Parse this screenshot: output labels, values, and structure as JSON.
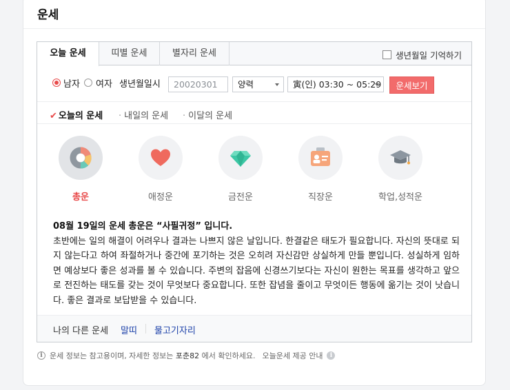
{
  "title": "운세",
  "tabs": [
    {
      "label": "오늘 운세"
    },
    {
      "label": "띠별 운세"
    },
    {
      "label": "별자리 운세"
    }
  ],
  "remember_label": "생년월일 기억하기",
  "form": {
    "gender_male": "남자",
    "gender_female": "여자",
    "birth_label": "생년월일시",
    "birth_placeholder": "20020301",
    "calendar": "양력",
    "time": "寅(인) 03:30 ~ 05:29",
    "submit": "운세보기"
  },
  "subtabs": [
    {
      "label": "오늘의 운세"
    },
    {
      "label": "내일의 운세"
    },
    {
      "label": "이달의 운세"
    }
  ],
  "categories": [
    {
      "label": "총운"
    },
    {
      "label": "애정운"
    },
    {
      "label": "금전운"
    },
    {
      "label": "직장운"
    },
    {
      "label": "학업,성적운"
    }
  ],
  "fortune": {
    "headline": "08월 19일의 운세 총운은 “사필귀정” 입니다.",
    "body": "초반에는 일의 해결이 어려우나 결과는 나쁘지 않은 날입니다. 한결같은 태도가 필요합니다. 자신의 뜻대로 되지 않는다고 하여 좌절하거나 중간에 포기하는 것은 오히려 자신감만 상실하게 만들 뿐입니다. 성실하게 임하면 예상보다 좋은 성과를 볼 수 있습니다. 주변의 잡음에 신경쓰기보다는 자신이 원한는 목표를 생각하고 앞으로 전진하는 태도를 갖는 것이 무엇보다 중요합니다. 또한 잡념을 줄이고 무엇이든 행동에 옮기는 것이 낫습니다. 좋은 결과로 보답받을 수 있습니다."
  },
  "footer": {
    "label": "나의 다른 운세",
    "link1": "말띠",
    "link2": "물고기자리"
  },
  "note": {
    "part1": "운세 정보는 참고용이며, 자세한 정보는",
    "bold": "포춘82",
    "part2": "에서 확인하세요.",
    "provider": "오늘운세 제공 안내"
  },
  "colors": {
    "accent": "#f26b6b",
    "link": "#1a3fa8",
    "selected_text": "#e84a4a"
  },
  "icons": [
    "pie-chart-icon",
    "heart-icon",
    "diamond-icon",
    "id-card-icon",
    "graduation-cap-icon",
    "info-icon"
  ]
}
